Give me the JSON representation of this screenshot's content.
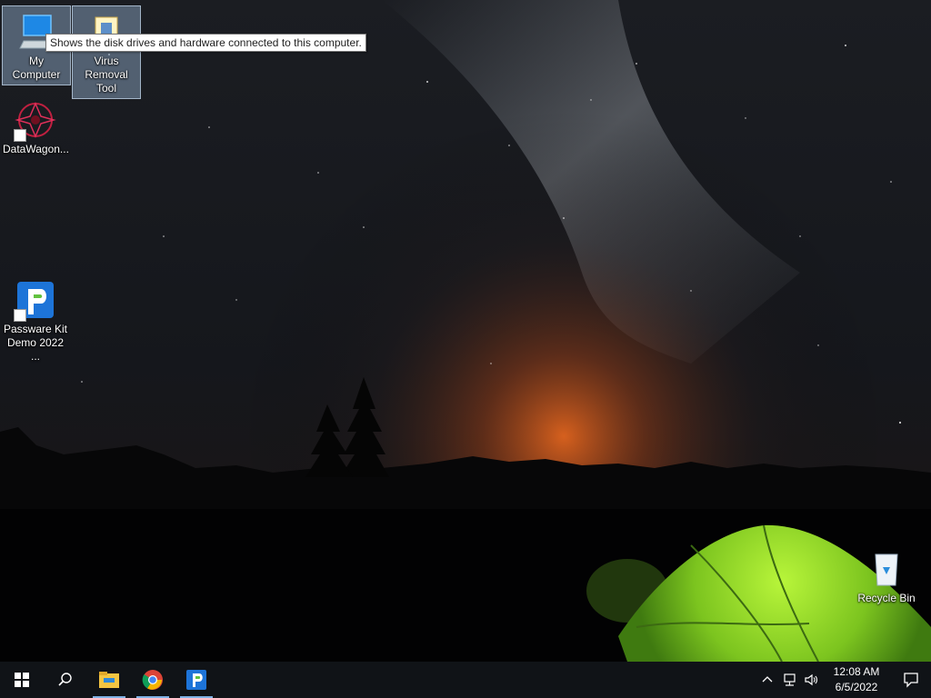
{
  "desktop": {
    "icons": [
      {
        "label": "My Computer",
        "icon": "computer-icon"
      },
      {
        "label": "Virus Removal Tool",
        "icon": "folder-file-icon"
      },
      {
        "label": "DataWagon...",
        "icon": "datawagon-icon"
      },
      {
        "label": "Passware Kit Demo 2022 ...",
        "icon": "passware-icon"
      },
      {
        "label": "Recycle Bin",
        "icon": "recycle-bin-icon"
      }
    ],
    "tooltip": "Shows the disk drives and hardware connected to this computer."
  },
  "taskbar": {
    "apps": [
      {
        "name": "Start",
        "icon": "windows-start-icon"
      },
      {
        "name": "Search",
        "icon": "search-icon"
      },
      {
        "name": "File Explorer",
        "icon": "file-explorer-icon"
      },
      {
        "name": "Google Chrome",
        "icon": "chrome-icon"
      },
      {
        "name": "Passware Kit",
        "icon": "passware-icon"
      }
    ],
    "tray": {
      "time": "12:08 AM",
      "date": "6/5/2022"
    }
  },
  "colors": {
    "taskbar_bg": "#101317",
    "selection": "#96b4d2",
    "tent": "#8fdc2a",
    "horizon_glow": "#e0641e"
  }
}
